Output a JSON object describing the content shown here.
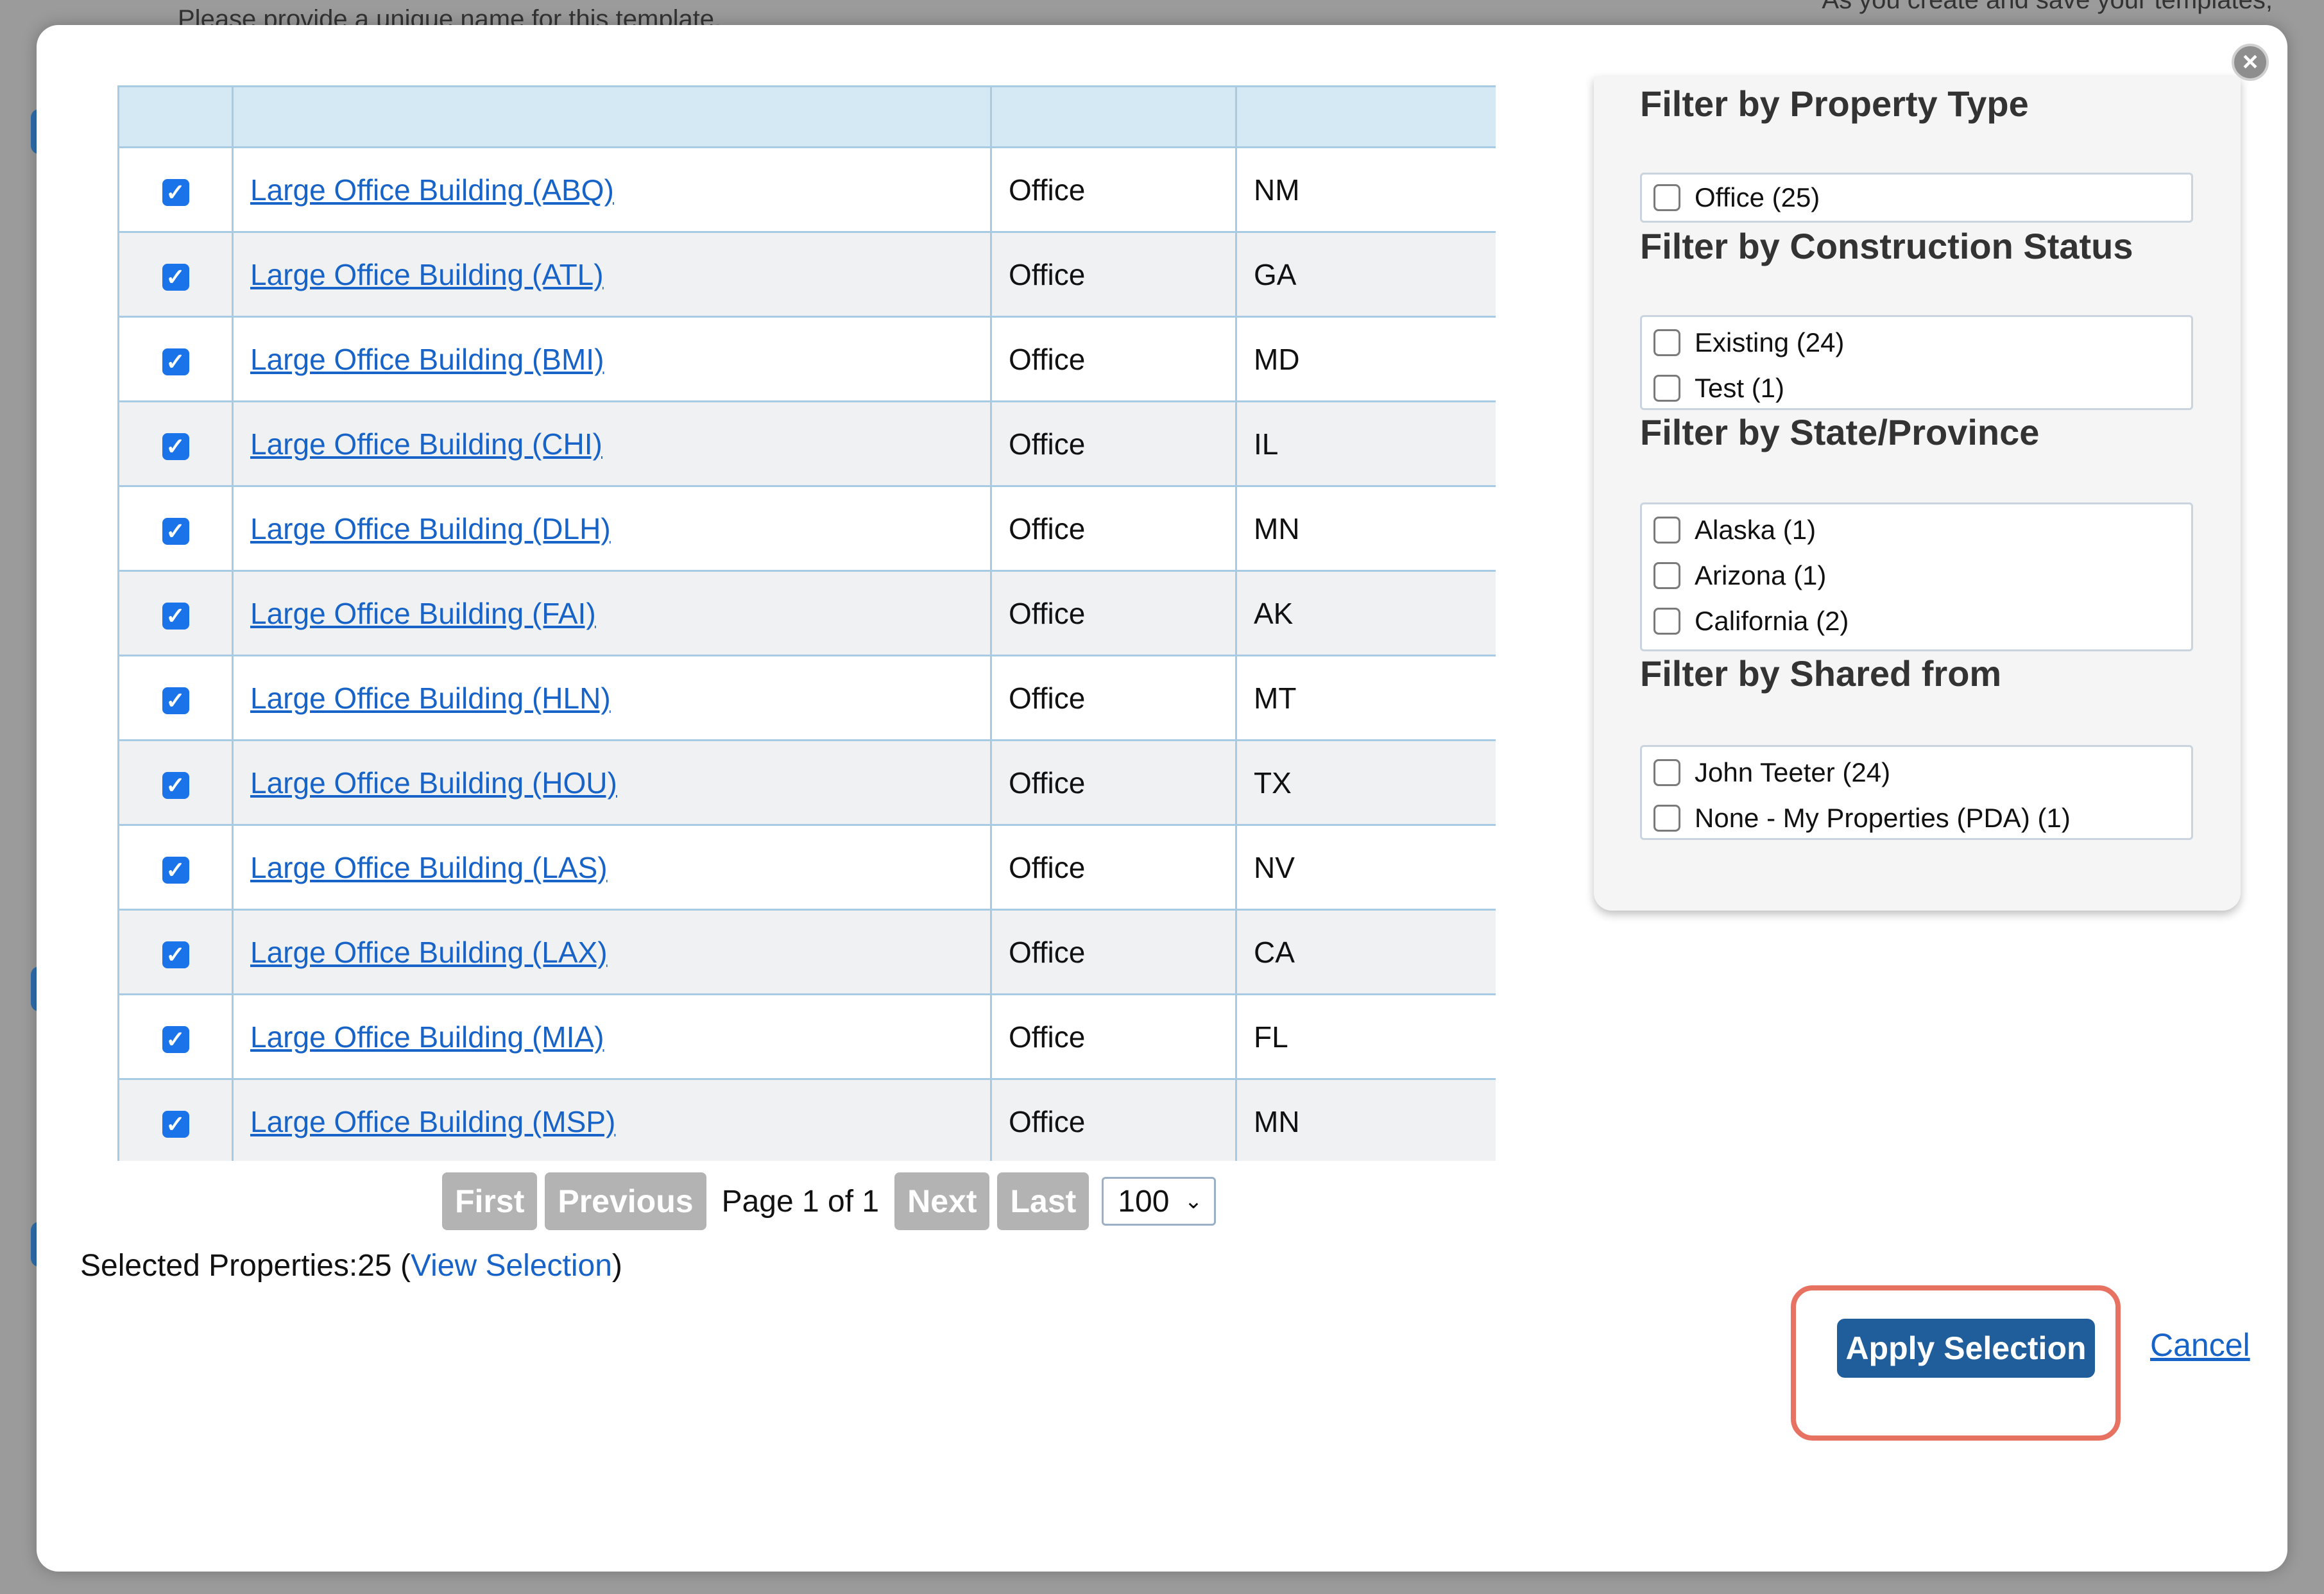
{
  "background": {
    "left_text": "Please provide a unique name for this template.",
    "right_text": "As you create and save your templates,"
  },
  "table": {
    "rows": [
      {
        "checked": true,
        "name": "Large Office Building (ABQ)",
        "type": "Office",
        "state": "NM"
      },
      {
        "checked": true,
        "name": "Large Office Building (ATL)",
        "type": "Office",
        "state": "GA"
      },
      {
        "checked": true,
        "name": "Large Office Building (BMI)",
        "type": "Office",
        "state": "MD"
      },
      {
        "checked": true,
        "name": "Large Office Building (CHI)",
        "type": "Office",
        "state": "IL"
      },
      {
        "checked": true,
        "name": "Large Office Building (DLH)",
        "type": "Office",
        "state": "MN"
      },
      {
        "checked": true,
        "name": "Large Office Building (FAI)",
        "type": "Office",
        "state": "AK"
      },
      {
        "checked": true,
        "name": "Large Office Building (HLN)",
        "type": "Office",
        "state": "MT"
      },
      {
        "checked": true,
        "name": "Large Office Building (HOU)",
        "type": "Office",
        "state": "TX"
      },
      {
        "checked": true,
        "name": "Large Office Building (LAS)",
        "type": "Office",
        "state": "NV"
      },
      {
        "checked": true,
        "name": "Large Office Building (LAX)",
        "type": "Office",
        "state": "CA"
      },
      {
        "checked": true,
        "name": "Large Office Building (MIA)",
        "type": "Office",
        "state": "FL"
      },
      {
        "checked": true,
        "name": "Large Office Building (MSP)",
        "type": "Office",
        "state": "MN"
      }
    ]
  },
  "pager": {
    "first": "First",
    "previous": "Previous",
    "page_info": "Page 1 of 1",
    "next": "Next",
    "last": "Last",
    "page_size": "100"
  },
  "selection": {
    "label": "Selected Properties:25",
    "open_paren": " (",
    "view_link": "View Selection",
    "close_paren": ")"
  },
  "filters": {
    "property_type": {
      "title": "Filter by Property Type",
      "options": [
        "Office (25)"
      ]
    },
    "construction_status": {
      "title": "Filter by Construction Status",
      "options": [
        "Existing (24)",
        "Test (1)"
      ]
    },
    "state": {
      "title": "Filter by State/Province",
      "options": [
        "Alaska (1)",
        "Arizona (1)",
        "California (2)"
      ]
    },
    "shared_from": {
      "title": "Filter by Shared from",
      "options": [
        "John Teeter (24)",
        "None - My Properties (PDA) (1)"
      ]
    }
  },
  "actions": {
    "apply": "Apply Selection",
    "cancel": "Cancel"
  },
  "icons": {
    "close": "close-icon",
    "checkbox_checked": "checkmark-icon",
    "dropdown": "chevron-down-icon"
  },
  "colors": {
    "accent": "#1f5d9b",
    "link": "#1763c7",
    "highlight": "#e87262",
    "checkbox": "#1a73e8"
  }
}
